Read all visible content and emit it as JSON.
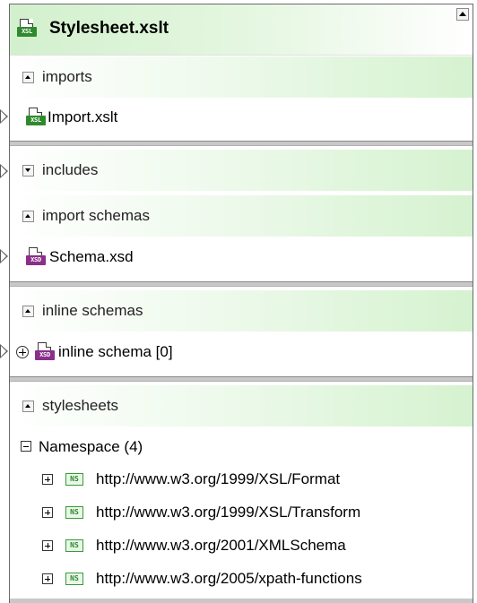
{
  "title": "Stylesheet.xslt",
  "sections": {
    "imports": {
      "label": "imports",
      "item": "Import.xslt"
    },
    "includes": {
      "label": "includes"
    },
    "import_schemas": {
      "label": "import schemas",
      "item": "Schema.xsd"
    },
    "inline_schemas": {
      "label": "inline schemas",
      "item": "inline schema [0]"
    },
    "stylesheets": {
      "label": "stylesheets",
      "namespace_group": "Namespace (4)",
      "namespaces": [
        "http://www.w3.org/1999/XSL/Format",
        "http://www.w3.org/1999/XSL/Transform",
        "http://www.w3.org/2001/XMLSchema",
        "http://www.w3.org/2005/xpath-functions"
      ]
    }
  },
  "icons": {
    "xsl_tag": "XSL",
    "xsd_tag": "XSD",
    "ns_tag": "NS"
  },
  "colors": {
    "header_green": "#d5f2cf",
    "xsl_icon": "#2f8a2f",
    "xsd_icon": "#8a2f8a",
    "separator": "#c8c8c8"
  }
}
